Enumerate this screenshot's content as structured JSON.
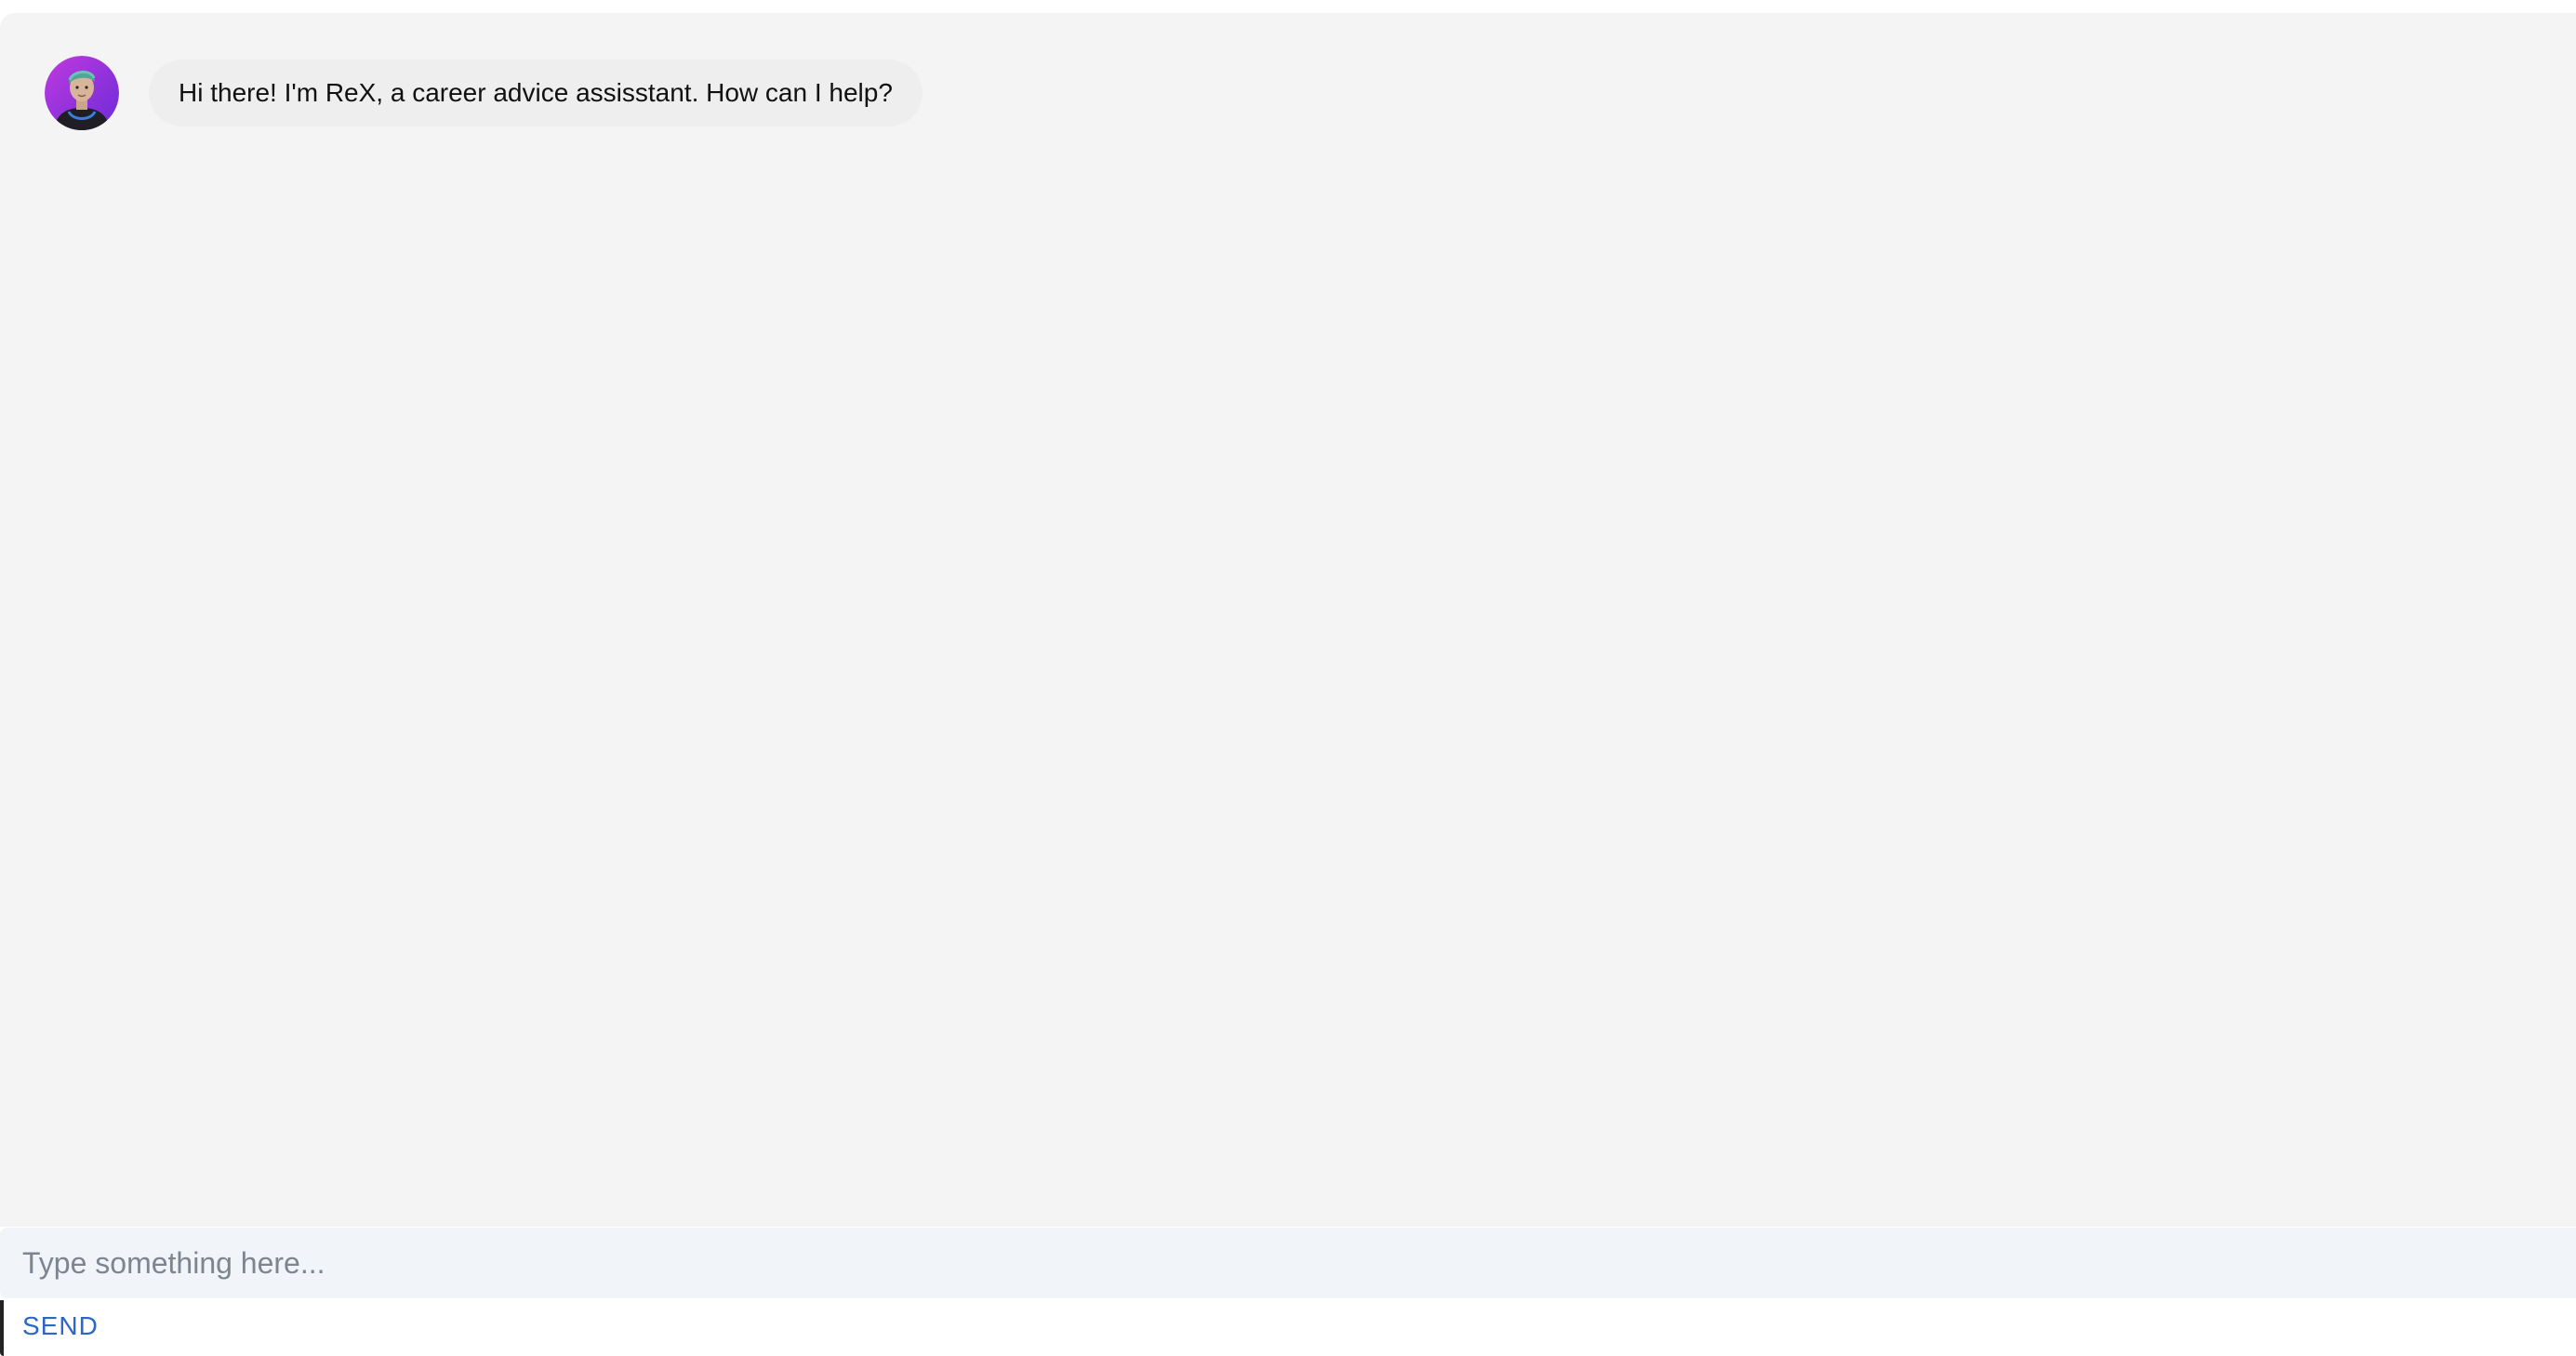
{
  "chat": {
    "messages": [
      {
        "sender": "ReX",
        "avatar_icon": "assistant-avatar-icon",
        "text": "Hi there! I'm ReX, a career advice assisstant. How can I help?"
      }
    ]
  },
  "composer": {
    "placeholder": "Type something here...",
    "value": "",
    "send_label": "SEND"
  },
  "colors": {
    "chat_background": "#f4f4f4",
    "bubble_background": "#eeeeee",
    "input_background": "#f1f4f8",
    "send_accent": "#2d66c3",
    "avatar_gradient_start": "#c03ae0",
    "avatar_gradient_end": "#6a2bd8"
  }
}
